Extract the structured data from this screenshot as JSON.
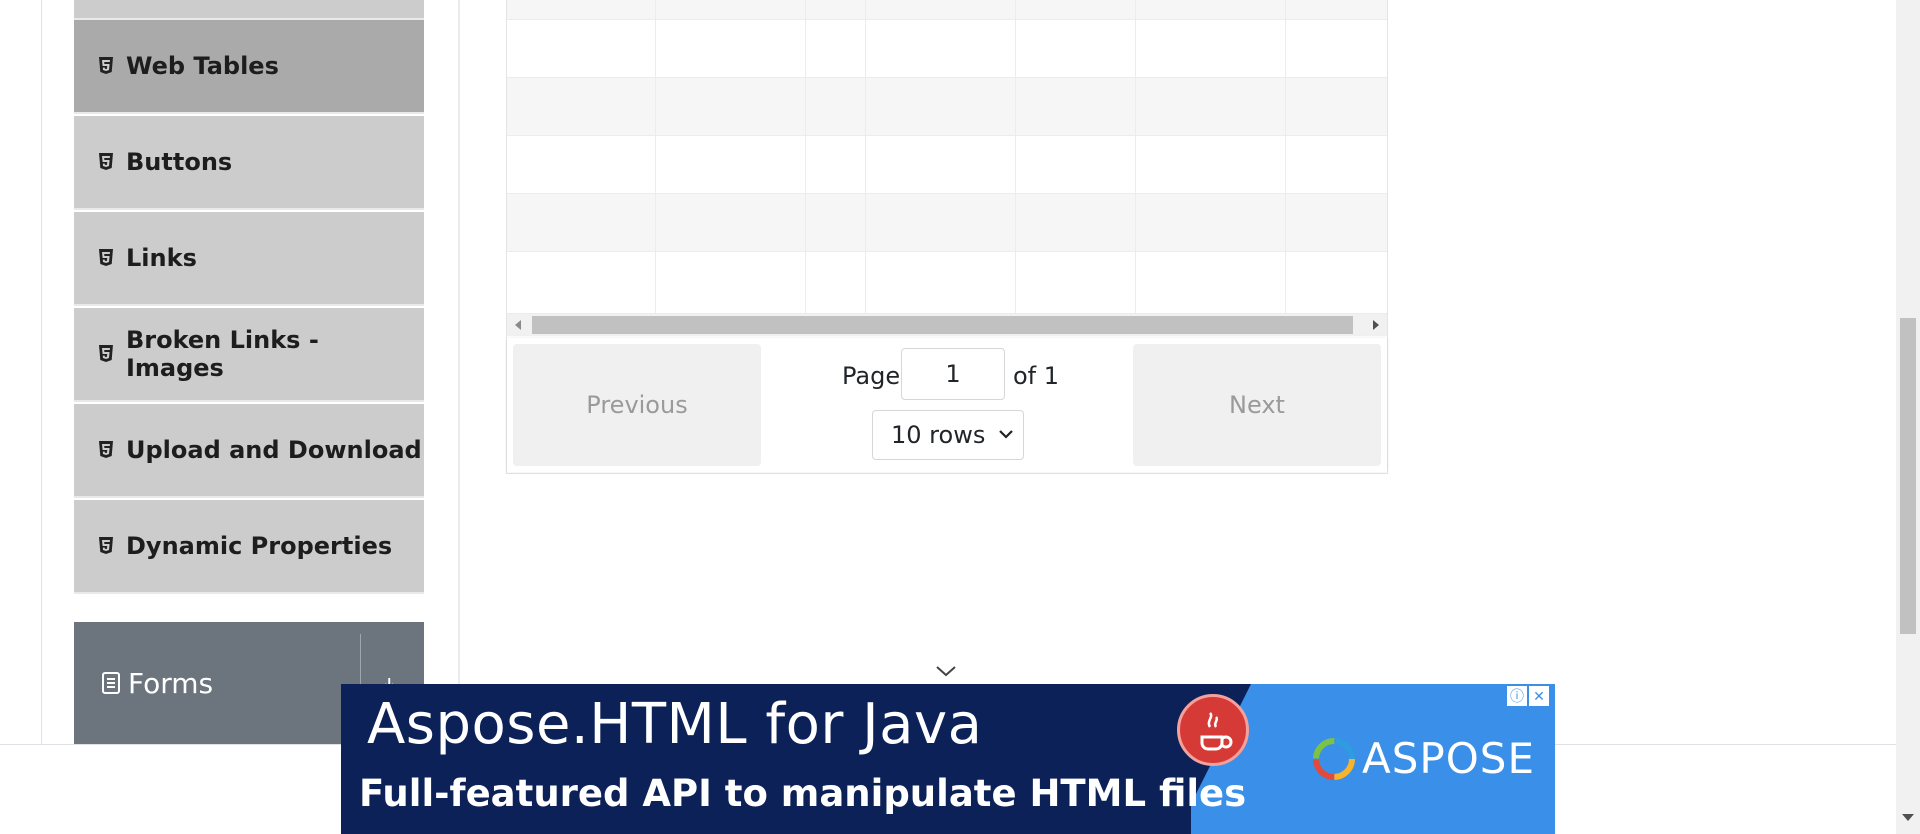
{
  "sidebar": {
    "items": [
      {
        "label": "Web Tables",
        "active": true
      },
      {
        "label": "Buttons",
        "active": false
      },
      {
        "label": "Links",
        "active": false
      },
      {
        "label": "Broken Links - Images",
        "active": false
      },
      {
        "label": "Upload and Download",
        "active": false
      },
      {
        "label": "Dynamic Properties",
        "active": false
      }
    ],
    "forms_group": {
      "label": "Forms"
    }
  },
  "table": {
    "pagination": {
      "previous_label": "Previous",
      "next_label": "Next",
      "page_label": "Page",
      "page_value": "1",
      "of_label": "of 1",
      "rows_selected": "10 rows"
    }
  },
  "ad": {
    "headline": "Aspose.HTML for Java",
    "subline": "Full-featured API to manipulate HTML files",
    "brand": "ASPOSE"
  },
  "colors": {
    "sidebar_item_bg": "#cccccc",
    "sidebar_item_active_bg": "#aaaaaa",
    "forms_group_bg": "#6c757d",
    "ad_bg": "#0c2157",
    "ad_accent": "#3a8fe8"
  }
}
